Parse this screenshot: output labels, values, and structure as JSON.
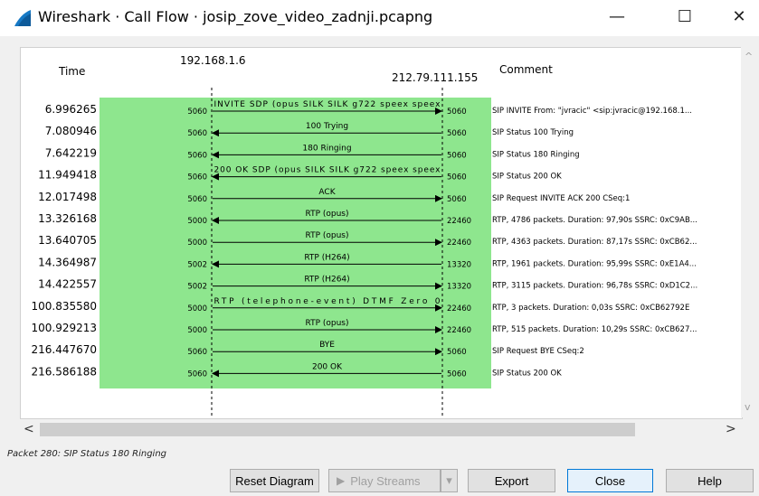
{
  "window": {
    "title": "Wireshark · Call Flow · josip_zove_video_zadnji.pcapng",
    "minimize": "—",
    "maximize": "☐",
    "close": "✕"
  },
  "diagram": {
    "time_header": "Time",
    "comment_header": "Comment",
    "left_host": "192.168.1.6",
    "right_host": "212.79.111.155",
    "highlight_color": "#8ee68e",
    "rows": [
      {
        "time": "6.996265",
        "lport": "5060",
        "rport": "5060",
        "label": "INVITE SDP (opus SILK SILK g722 speex speex",
        "dir": "right",
        "comment": "SIP INVITE From: \"jvracic\" <sip:jvracic@192.168.1..."
      },
      {
        "time": "7.080946",
        "lport": "5060",
        "rport": "5060",
        "label": "100 Trying",
        "dir": "left",
        "comment": "SIP Status 100 Trying"
      },
      {
        "time": "7.642219",
        "lport": "5060",
        "rport": "5060",
        "label": "180 Ringing",
        "dir": "left",
        "comment": "SIP Status 180 Ringing"
      },
      {
        "time": "11.949418",
        "lport": "5060",
        "rport": "5060",
        "label": "200 OK SDP (opus SILK SILK g722 speex speex",
        "dir": "left",
        "comment": "SIP Status 200 OK"
      },
      {
        "time": "12.017498",
        "lport": "5060",
        "rport": "5060",
        "label": "ACK",
        "dir": "right",
        "comment": "SIP Request INVITE ACK 200 CSeq:1"
      },
      {
        "time": "13.326168",
        "lport": "5000",
        "rport": "22460",
        "label": "RTP (opus)",
        "dir": "left",
        "comment": "RTP, 4786 packets. Duration: 97,90s SSRC: 0xC9AB..."
      },
      {
        "time": "13.640705",
        "lport": "5000",
        "rport": "22460",
        "label": "RTP (opus)",
        "dir": "right",
        "comment": "RTP, 4363 packets. Duration: 87,17s SSRC: 0xCB62..."
      },
      {
        "time": "14.364987",
        "lport": "5002",
        "rport": "13320",
        "label": "RTP (H264)",
        "dir": "left",
        "comment": "RTP, 1961 packets. Duration: 95,99s SSRC: 0xE1A4..."
      },
      {
        "time": "14.422557",
        "lport": "5002",
        "rport": "13320",
        "label": "RTP (H264)",
        "dir": "right",
        "comment": "RTP, 3115 packets. Duration: 96,78s SSRC: 0xD1C2..."
      },
      {
        "time": "100.835580",
        "lport": "5000",
        "rport": "22460",
        "label": "RTP (telephone-event) DTMF Zero 0",
        "dir": "right",
        "comment": "RTP, 3 packets. Duration: 0,03s SSRC: 0xCB62792E"
      },
      {
        "time": "100.929213",
        "lport": "5000",
        "rport": "22460",
        "label": "RTP (opus)",
        "dir": "right",
        "comment": "RTP, 515 packets. Duration: 10,29s SSRC: 0xCB627..."
      },
      {
        "time": "216.447670",
        "lport": "5060",
        "rport": "5060",
        "label": "BYE",
        "dir": "right",
        "comment": "SIP Request BYE CSeq:2"
      },
      {
        "time": "216.586188",
        "lport": "5060",
        "rport": "5060",
        "label": "200 OK",
        "dir": "left",
        "comment": "SIP Status 200 OK"
      }
    ]
  },
  "scrollbars": {
    "left_arrow": "<",
    "right_arrow": ">",
    "up_arrow": "^",
    "down_arrow": "v"
  },
  "status_text": "Packet 280: SIP Status 180 Ringing",
  "buttons": {
    "reset": "Reset Diagram",
    "play": "Play Streams",
    "play_icon": "▶",
    "play_dropdown": "▾",
    "export": "Export",
    "close": "Close",
    "help": "Help"
  }
}
